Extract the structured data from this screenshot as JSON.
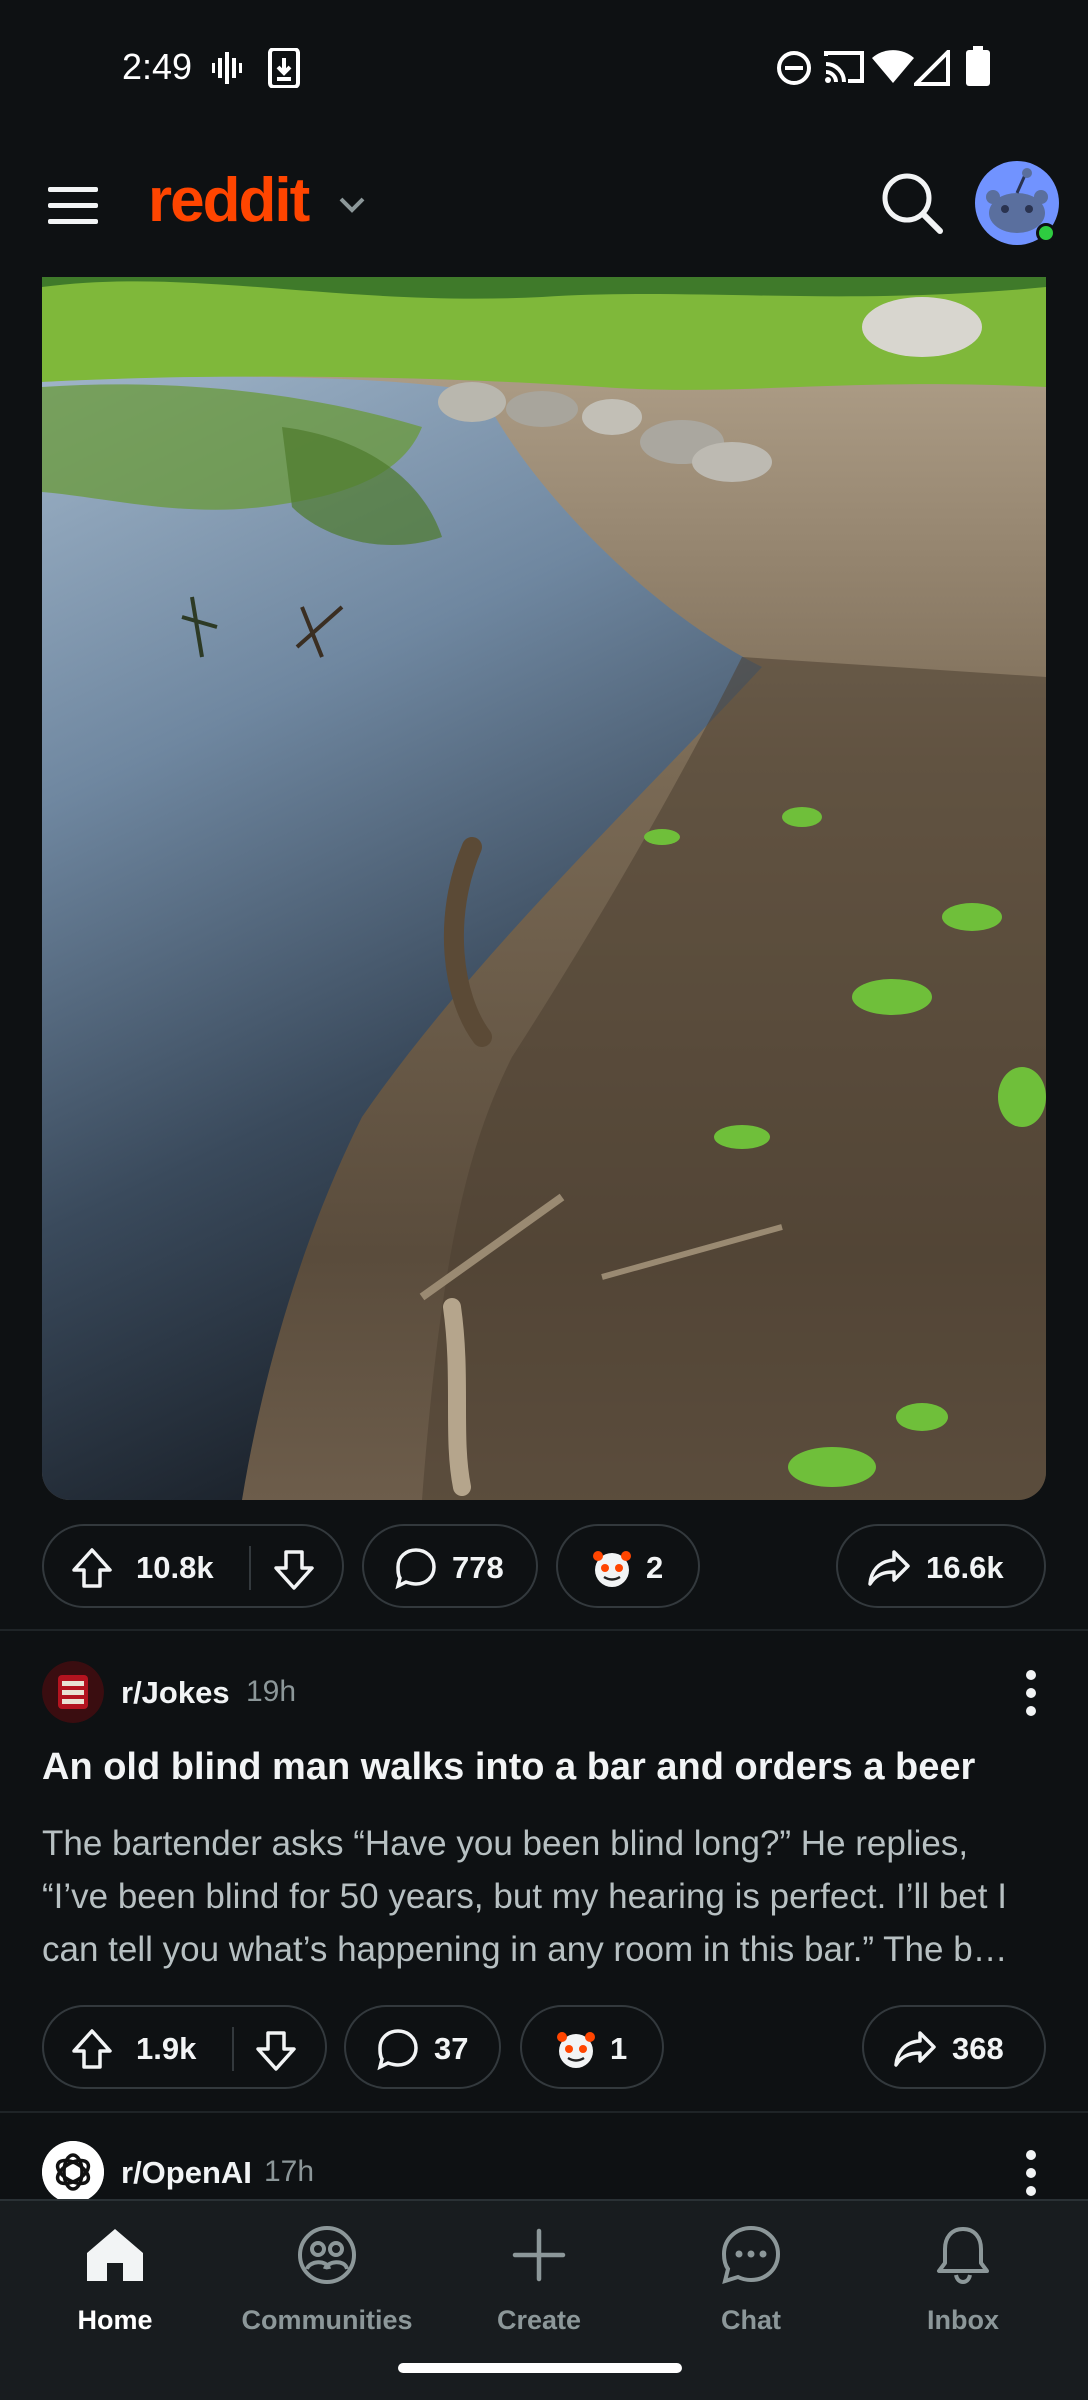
{
  "status_bar": {
    "time": "2:49"
  },
  "header": {
    "logo": "reddit"
  },
  "post_1": {
    "upvotes": "10.8k",
    "comments": "778",
    "awards": "2",
    "shares": "16.6k"
  },
  "post_2": {
    "subreddit": "r/Jokes",
    "age": "19h",
    "title": "An old blind man walks into a bar and orders a beer",
    "body": "The bartender asks “Have you been blind long?” He replies, “I’ve been blind for 50 years, but my hearing is perfect. I’ll bet I can tell you what’s happening in any room in this bar.” The b…",
    "upvotes": "1.9k",
    "comments": "37",
    "awards": "1",
    "shares": "368"
  },
  "post_3": {
    "subreddit": "r/OpenAI",
    "age": "17h"
  },
  "bottom_nav": [
    {
      "label": "Home",
      "icon": "home-icon"
    },
    {
      "label": "Communities",
      "icon": "communities-icon"
    },
    {
      "label": "Create",
      "icon": "plus-icon"
    },
    {
      "label": "Chat",
      "icon": "chat-icon"
    },
    {
      "label": "Inbox",
      "icon": "bell-icon"
    }
  ],
  "colors": {
    "brand": "#ff4500",
    "background": "#0e1113",
    "online": "#2ecc40",
    "avatar": "#7193ff"
  }
}
